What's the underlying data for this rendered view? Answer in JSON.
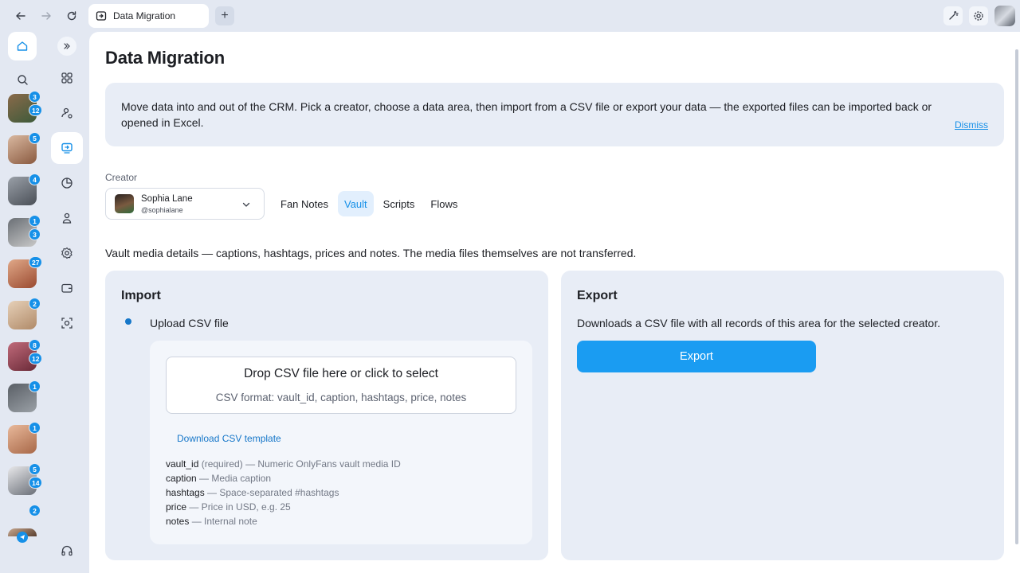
{
  "browser": {
    "tab_title": "Data Migration",
    "new_tab_symbol": "+"
  },
  "rail": {
    "creators": [
      {
        "badges": [
          "3",
          "12"
        ],
        "colors": [
          "#8a6a4a",
          "#3d5a3a"
        ]
      },
      {
        "badges": [
          "5"
        ],
        "colors": [
          "#d9b8a0",
          "#8a5a40"
        ]
      },
      {
        "badges": [
          "4"
        ],
        "colors": [
          "#9aa0a8",
          "#4a4f57"
        ]
      },
      {
        "badges": [
          "1",
          "3"
        ],
        "colors": [
          "#6a6f75",
          "#c8c8c8"
        ]
      },
      {
        "badges": [
          "27"
        ],
        "colors": [
          "#e0a888",
          "#9a4a30"
        ]
      },
      {
        "badges": [
          "2"
        ],
        "colors": [
          "#e6d0b8",
          "#b08a68"
        ]
      },
      {
        "badges": [
          "8",
          "12"
        ],
        "colors": [
          "#c06a7a",
          "#6a2a38"
        ]
      },
      {
        "badges": [
          "1"
        ],
        "colors": [
          "#5a5f66",
          "#9aa0a6"
        ]
      },
      {
        "badges": [
          "1"
        ],
        "colors": [
          "#e8b89a",
          "#a86848"
        ]
      },
      {
        "badges": [
          "5",
          "14"
        ],
        "colors": [
          "#e8e8ea",
          "#6a6f78"
        ]
      },
      {
        "badges": [
          "2"
        ],
        "colors": [
          "#c8a890",
          "#5a4030"
        ]
      }
    ]
  },
  "page": {
    "title": "Data Migration"
  },
  "notice": {
    "text": "Move data into and out of the CRM. Pick a creator, choose a data area, then import from a CSV file or export your data — the exported files can be imported back or opened in Excel.",
    "dismiss": "Dismiss"
  },
  "creator_picker": {
    "label": "Creator",
    "name": "Sophia Lane",
    "handle": "@sophialane"
  },
  "areas": [
    {
      "label": "Fan Notes",
      "active": false
    },
    {
      "label": "Vault",
      "active": true
    },
    {
      "label": "Scripts",
      "active": false
    },
    {
      "label": "Flows",
      "active": false
    }
  ],
  "area_description": "Vault media details — captions, hashtags, prices and notes. The media files themselves are not transferred.",
  "import": {
    "title": "Import",
    "option_label": "Upload CSV file",
    "dropzone_title": "Drop CSV file here or click to select",
    "dropzone_format": "CSV format: vault_id, caption, hashtags, price, notes",
    "template_link": "Download CSV template",
    "fields": [
      {
        "name": "vault_id",
        "desc": " (required) — Numeric OnlyFans vault media ID"
      },
      {
        "name": "caption",
        "desc": " — Media caption"
      },
      {
        "name": "hashtags",
        "desc": " — Space-separated #hashtags"
      },
      {
        "name": "price",
        "desc": " — Price in USD, e.g. 25"
      },
      {
        "name": "notes",
        "desc": " — Internal note"
      }
    ]
  },
  "export": {
    "title": "Export",
    "description": "Downloads a CSV file with all records of this area for the selected creator.",
    "button": "Export"
  },
  "colors": {
    "accent": "#1a9cf2",
    "badge": "#1690e8",
    "panel_bg": "#e8edf6",
    "chrome_bg": "#e3e8f2"
  }
}
